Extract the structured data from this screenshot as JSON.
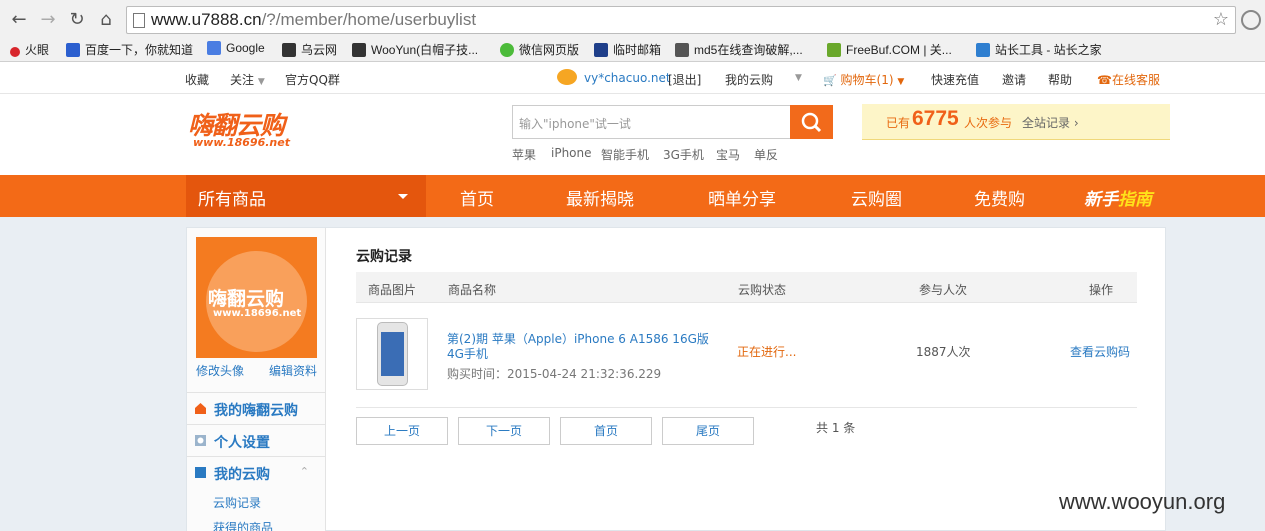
{
  "browser": {
    "url_host": "www.u7888.cn",
    "url_path": "/?/member/home/userbuylist",
    "bookmarks": [
      "火眼",
      "百度一下，你就知道",
      "Google",
      "乌云网",
      "WooYun(白帽子技...",
      "微信网页版",
      "临时邮箱",
      "md5在线查询破解,...",
      "FreeBuf.COM | 关...",
      "站长工具 - 站长之家"
    ]
  },
  "topbar": {
    "fav": "收藏",
    "follow": "关注",
    "qq": "官方QQ群",
    "user": "vy*chacuo.net",
    "logout": "[退出]",
    "my_yungou": "我的云购",
    "cart": "购物车(1)",
    "recharge": "快速充值",
    "invite": "邀请",
    "help": "帮助",
    "service": "在线客服"
  },
  "header": {
    "logo": "嗨翻云购",
    "logo_url": "www.18696.net",
    "search_placeholder": "输入\"iphone\"试一试",
    "hot": [
      "苹果",
      "iPhone",
      "智能手机",
      "3G手机",
      "宝马",
      "单反"
    ],
    "stats_prefix": "已有",
    "stats_num": "6775",
    "stats_suffix": "人次参与",
    "stats_link": "全站记录 ›"
  },
  "nav": {
    "all": "所有商品",
    "items": [
      "首页",
      "最新揭晓",
      "晒单分享",
      "云购圈",
      "免费购"
    ],
    "guide_a": "新手",
    "guide_b": "指南"
  },
  "sidebar": {
    "avatar_title": "嗨翻云购",
    "avatar_url": "www.18696.net",
    "edit_avatar": "修改头像",
    "edit_profile": "编辑资料",
    "sec1": "我的嗨翻云购",
    "sec2": "个人设置",
    "sec3": "我的云购",
    "sub1": "云购记录",
    "sub2": "获得的商品"
  },
  "main": {
    "title": "云购记录",
    "headers": [
      "商品图片",
      "商品名称",
      "云购状态",
      "参与人次",
      "操作"
    ],
    "row": {
      "name": "第(2)期 苹果（Apple）iPhone 6 A1586 16G版 4G手机",
      "time": "购买时间：2015-04-24 21:32:36.229",
      "status": "正在进行...",
      "count": "1887人次",
      "action": "查看云购码"
    },
    "pager": [
      "上一页",
      "下一页",
      "首页",
      "尾页"
    ],
    "total": "共 1 条"
  },
  "watermark": "www.wooyun.org"
}
